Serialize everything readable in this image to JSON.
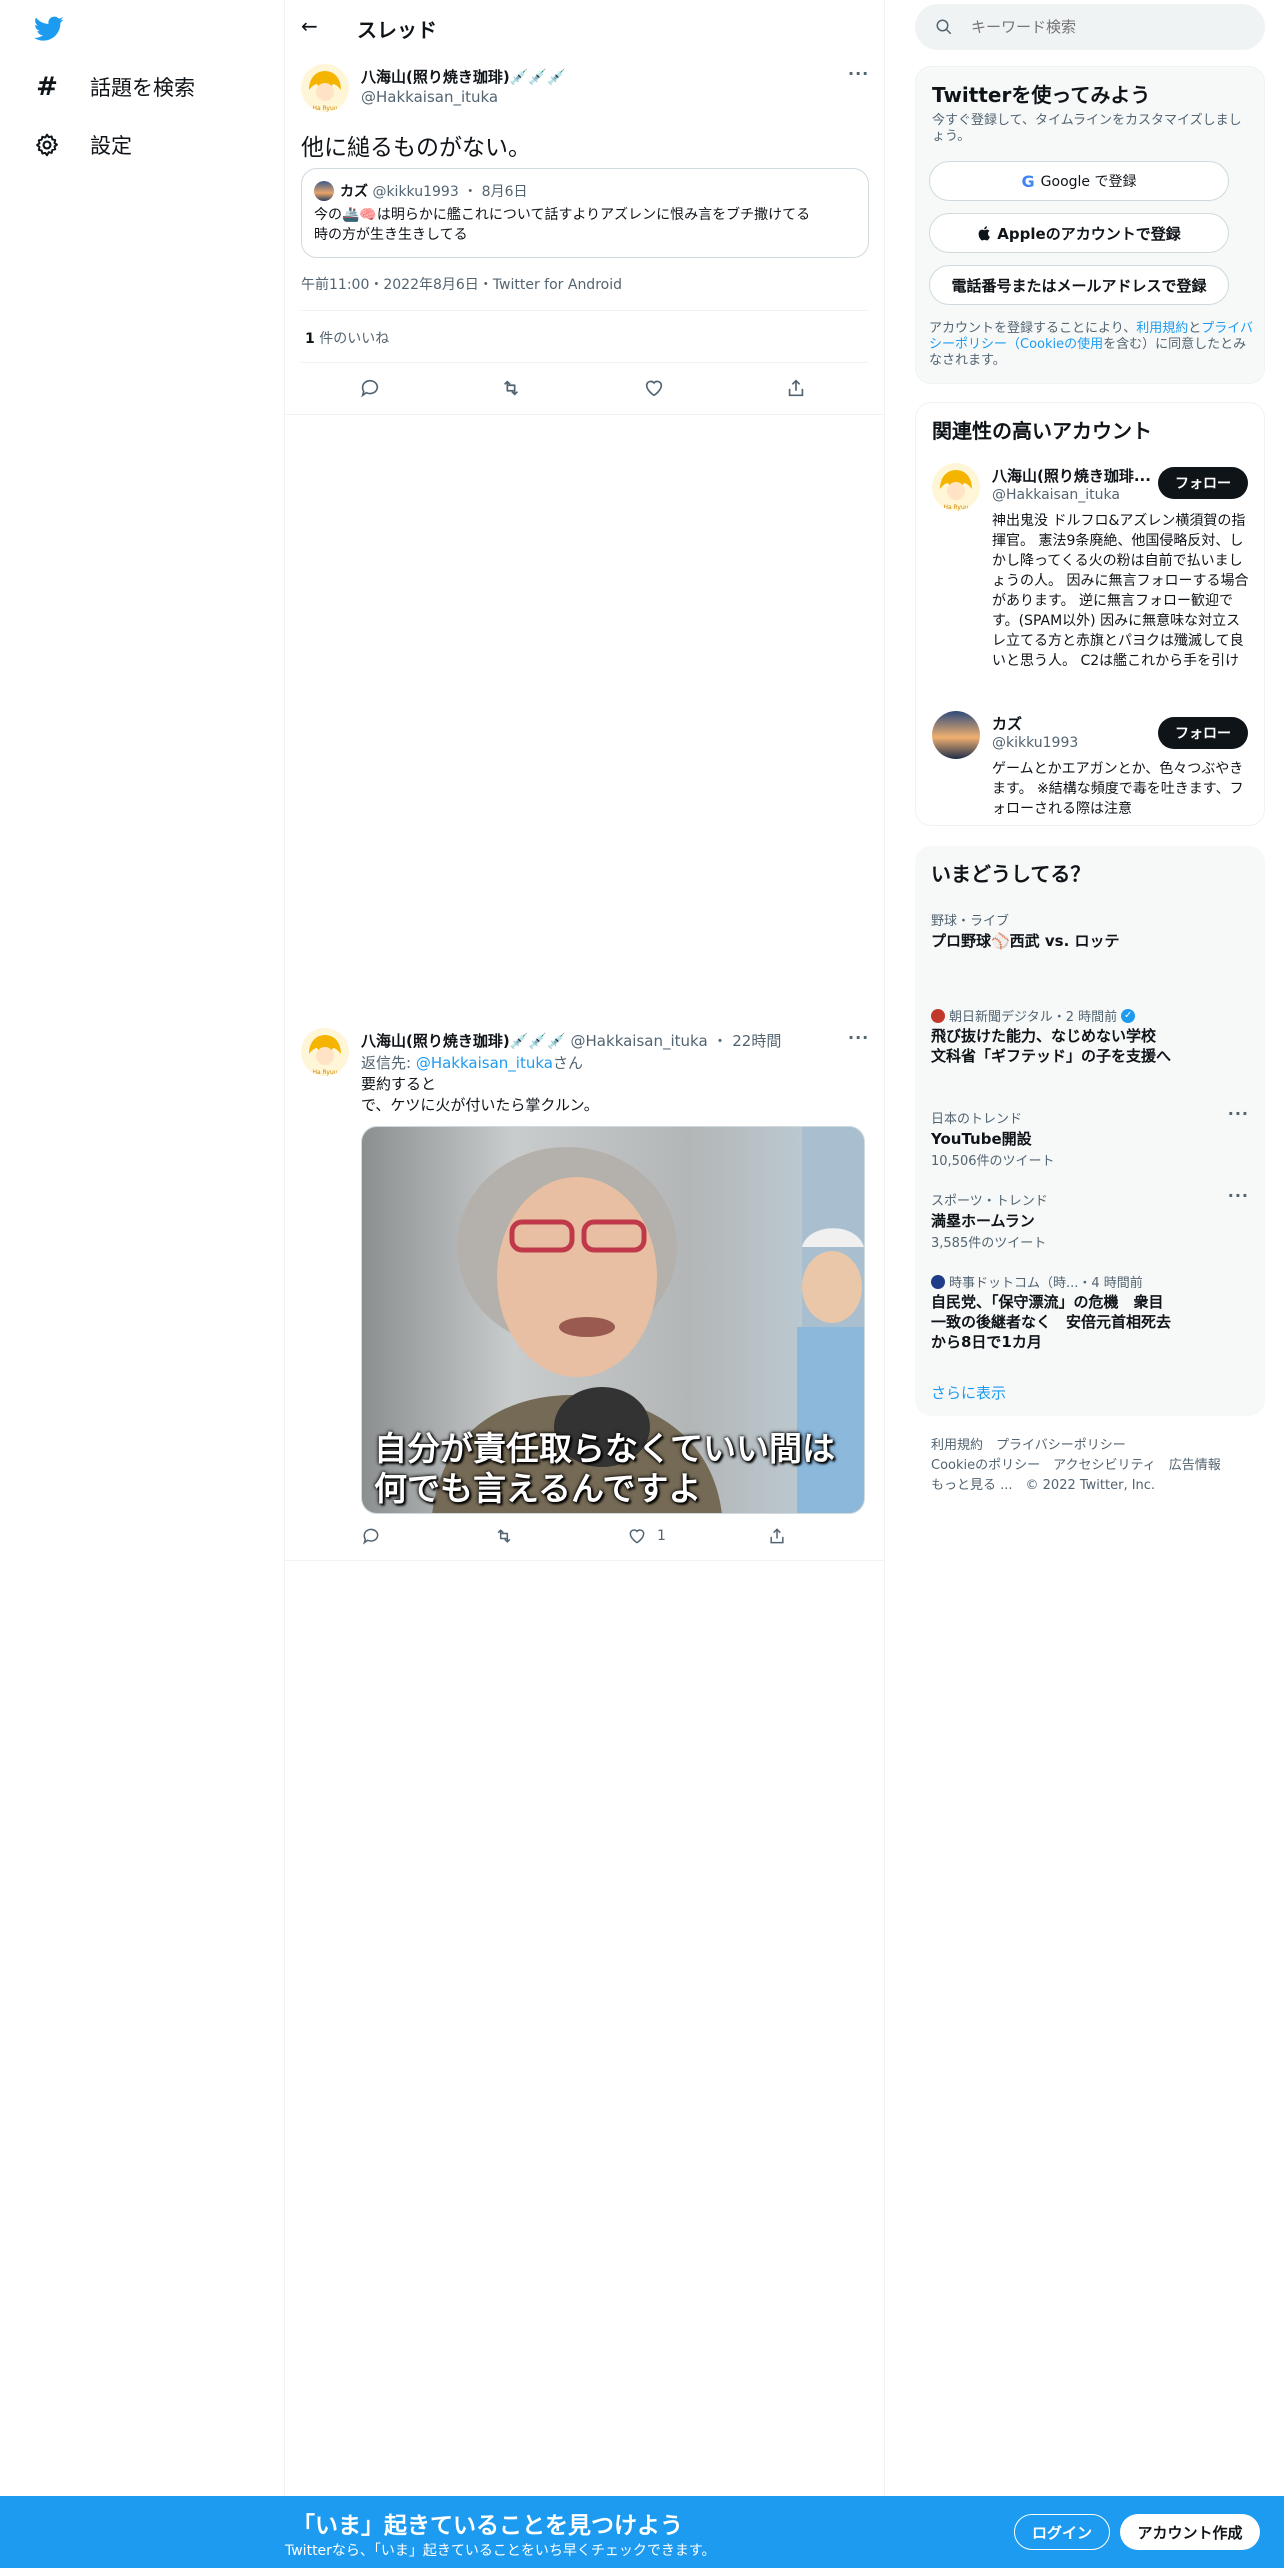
{
  "nav": {
    "items": [
      {
        "label": "話題を検索",
        "icon": "hash-icon"
      },
      {
        "label": "設定",
        "icon": "gear-icon"
      }
    ]
  },
  "header": {
    "title": "スレッド"
  },
  "main_tweet": {
    "author_name": "八海山(照り焼き珈琲)💉💉💉",
    "handle": "@Hakkaisan_ituka",
    "text": "他に縋るものがない。",
    "quoted": {
      "name": "カズ",
      "handle": "@kikku1993",
      "date": "8月6日",
      "text_line1": "今の🚢🧠は明らかに艦これについて話すよりアズレンに恨み言をブチ撒けてる",
      "text_line2": "時の方が生き生きしてる"
    },
    "meta": "午前11:00・2022年8月6日・Twitter for Android",
    "likes_count": "1",
    "likes_label": "件のいいね"
  },
  "reply_tweet": {
    "author_name": "八海山(照り焼き珈琲)💉💉💉",
    "handle": "@Hakkaisan_ituka",
    "time": "22時間",
    "reply_prefix": "返信先: ",
    "reply_to": "@Hakkaisan_ituka",
    "reply_suffix": "さん",
    "text_line1": "要約すると",
    "text_line2": "で、ケツに火が付いたら掌クルン。",
    "image_caption_line1": "自分が責任取らなくていい間は",
    "image_caption_line2": "何でも言えるんですよ",
    "like_count": "1"
  },
  "search": {
    "placeholder": "キーワード検索"
  },
  "signup": {
    "title": "Twitterを使ってみよう",
    "subtitle": "今すぐ登録して、タイムラインをカスタマイズしましょう。",
    "google": "Google で登録",
    "apple": "Appleのアカウントで登録",
    "phone": "電話番号またはメールアドレスで登録",
    "terms_prefix": "アカウントを登録することにより、",
    "terms_link": "利用規約",
    "terms_and": "と",
    "privacy_link": "プライバシーポリシー（Cookieの使用",
    "terms_suffix": "を含む）に同意したとみなされます。"
  },
  "related": {
    "title": "関連性の高いアカウント",
    "follow_label": "フォロー",
    "accounts": [
      {
        "name": "八海山(照り焼き珈琲...",
        "handle": "@Hakkaisan_ituka",
        "bio": "神出鬼没 ドルフロ&アズレン横須賀の指揮官。 憲法9条廃絶、他国侵略反対、しかし降ってくる火の粉は自前で払いましょうの人。 因みに無言フォローする場合があります。 逆に無言フォロー歓迎です。(SPAM以外) 因みに無意味な対立スレ立てる方と赤旗とパヨクは殲滅して良いと思う人。 C2は艦これから手を引け"
      },
      {
        "name": "カズ",
        "handle": "@kikku1993",
        "bio": "ゲームとかエアガンとか、色々つぶやきます。 ※結構な頻度で毒を吐きます、フォローされる際は注意"
      }
    ]
  },
  "trends": {
    "title": "いまどうしてる？",
    "items": [
      {
        "context": "野球・ライブ",
        "title": "プロ野球⚾西武 vs. ロッテ",
        "count": ""
      },
      {
        "context": "朝日新聞デジタル・2 時間前",
        "title": "飛び抜けた能力、なじめない学校　文科省「ギフテッド」の子を支援へ",
        "count": ""
      },
      {
        "context": "日本のトレンド",
        "title": "YouTube開設",
        "count": "10,506件のツイート"
      },
      {
        "context": "スポーツ・トレンド",
        "title": "満塁ホームラン",
        "count": "3,585件のツイート"
      },
      {
        "context": "時事ドットコム（時...・4 時間前",
        "title": "自民党、「保守漂流」の危機　衆目一致の後継者なく　安倍元首相死去から8日で1カ月",
        "count": ""
      }
    ],
    "show_more": "さらに表示"
  },
  "footer": {
    "line1": "利用規約　プライバシーポリシー",
    "line2": "Cookieのポリシー　アクセシビリティ　広告情報",
    "line3": "もっと見る ...　© 2022 Twitter, Inc."
  },
  "banner": {
    "title": "「いま」起きていることを見つけよう",
    "subtitle": "Twitterなら、「いま」起きていることをいち早くチェックできます。",
    "login": "ログイン",
    "signup": "アカウント作成"
  },
  "colors": {
    "accent": "#1d9bf0",
    "text": "#0f1419",
    "muted": "#536471"
  }
}
